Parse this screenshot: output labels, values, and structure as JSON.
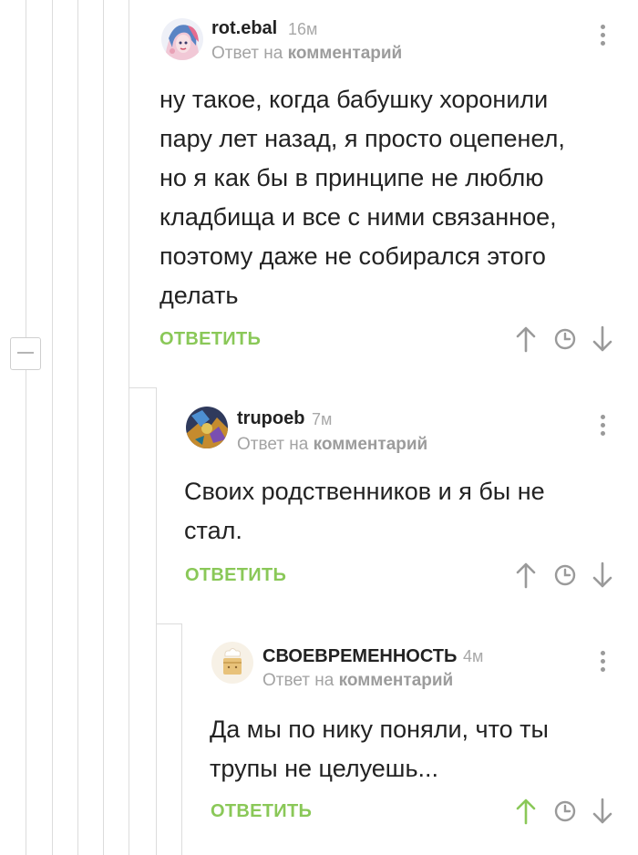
{
  "colors": {
    "accent": "#8ac858",
    "muted": "#a3a3a3",
    "text": "#222222",
    "thread_line": "#dcdcdc"
  },
  "thread": {
    "collapse_icon": "minus-icon"
  },
  "comments": [
    {
      "author": "rot.ebal",
      "time": "16м",
      "reply_prefix": "Ответ на",
      "reply_target": "комментарий",
      "body_lines": [
        "ну такое, когда бабушку хоронили",
        "пару лет назад, я просто оцепенел,",
        "но я как бы в принципе не люблю",
        "кладбища и все с ними связанное,",
        "поэтому даже не собирался этого",
        "делать"
      ],
      "reply_label": "ОТВЕТИТЬ",
      "upvote_active": false
    },
    {
      "author": "trupoeb",
      "time": "7м",
      "reply_prefix": "Ответ на",
      "reply_target": "комментарий",
      "body_lines": [
        "Своих родственников и я бы не",
        "стал."
      ],
      "reply_label": "ОТВЕТИТЬ",
      "upvote_active": false
    },
    {
      "author": "СВОЕВРЕМЕННОСТЬ",
      "time": "4м",
      "reply_prefix": "Ответ на",
      "reply_target": "комментарий",
      "body_lines": [
        "Да мы по нику поняли, что ты",
        "трупы не целуешь..."
      ],
      "reply_label": "ОТВЕТИТЬ",
      "upvote_active": true
    }
  ]
}
